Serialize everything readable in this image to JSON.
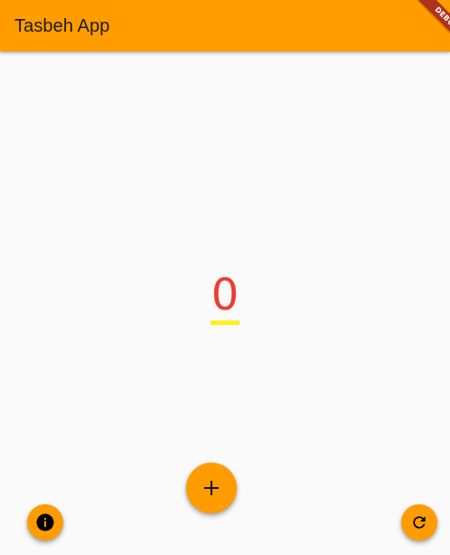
{
  "app_bar": {
    "title": "Tasbeh App",
    "background": "#ff9c00"
  },
  "debug_banner": {
    "label": "DEBUG",
    "color": "#b0321e"
  },
  "counter": {
    "value": "0",
    "text_color": "#f03b30",
    "underline_color": "#ffef1a"
  },
  "fabs": {
    "add": {
      "icon": "plus-icon"
    },
    "info": {
      "icon": "info-icon"
    },
    "refresh": {
      "icon": "refresh-icon"
    }
  }
}
